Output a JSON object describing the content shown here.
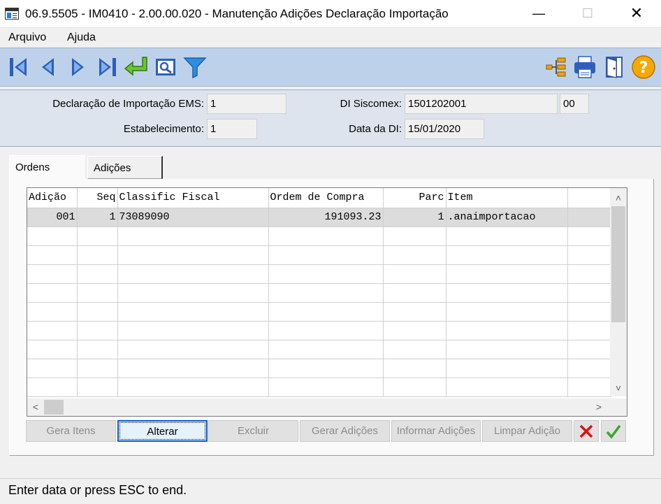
{
  "window": {
    "title": "06.9.5505 - IM0410 - 2.00.00.020 - Manutenção Adições Declaração Importação",
    "minimize_icon": "minimize-icon",
    "maximize_icon": "maximize-icon",
    "close_icon": "close-icon"
  },
  "menu": {
    "items": [
      "Arquivo",
      "Ajuda"
    ]
  },
  "toolbar": {
    "left_icons": [
      "first-record-icon",
      "previous-record-icon",
      "next-record-icon",
      "last-record-icon",
      "goto-icon",
      "search-icon",
      "filter-icon"
    ],
    "right_icons": [
      "tree-icon",
      "print-icon",
      "exit-icon",
      "help-icon"
    ],
    "accent": "#2e5fb8"
  },
  "header": {
    "declaracao_label": "Declaração de Importação EMS:",
    "declaracao_value": "1",
    "estabelecimento_label": "Estabelecimento:",
    "estabelecimento_value": "1",
    "di_siscomex_label": "DI Siscomex:",
    "di_siscomex_value": "1501202001",
    "di_siscomex_suffix": "00",
    "data_di_label": "Data da DI:",
    "data_di_value": "15/01/2020"
  },
  "tabs": [
    {
      "label": "Ordens",
      "active": true
    },
    {
      "label": "Adições",
      "active": false
    }
  ],
  "grid": {
    "columns": [
      "Adição",
      "Seq",
      "Classific Fiscal",
      "Ordem de Compra",
      "Parc",
      "Item",
      ""
    ],
    "rows": [
      [
        "001",
        "1",
        "73089090",
        "191093.23",
        "1",
        ".anaimportacao",
        ""
      ]
    ]
  },
  "buttons": {
    "gera_itens": "Gera Itens",
    "alterar": "Alterar",
    "excluir": "Excluir",
    "gerar_adicoes": "Gerar Adições",
    "informar_adicoes": "Informar Adições",
    "limpar_adicao": "Limpar Adição",
    "cancel_icon": "cancel-x-icon",
    "confirm_icon": "confirm-check-icon"
  },
  "status": {
    "text": "Enter data or press ESC to end."
  }
}
